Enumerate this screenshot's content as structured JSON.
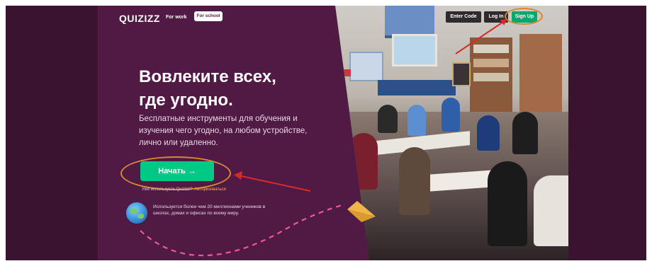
{
  "header": {
    "logo_text": "QUIZIZZ",
    "nav": {
      "for_work": "For work",
      "for_school": "For school"
    },
    "actions": {
      "enter_code": "Enter Code",
      "log_in": "Log In",
      "sign_up": "Sign Up"
    }
  },
  "hero": {
    "headline": "Вовлеките всех,\nгде угодно.",
    "subtitle": "Бесплатные инструменты для обучения и изучения чего угодно, на любом устройстве, лично или удаленно.",
    "cta_label": "Начать",
    "cta_arrow": "→",
    "already_text": "Уже используете Quizizz?",
    "login_link": "Авторизоваться",
    "stat_text": "Используется более чем 20 миллионами учеников в школах, домах и офисах по всему миру."
  },
  "colors": {
    "brand_purple": "#4b1a3f",
    "accent_green": "#00c985",
    "annotation_red": "#d62b2b",
    "annotation_orange": "#d9882f",
    "dash_pink": "#e85b97"
  },
  "icons": [
    "globe-icon",
    "paper-plane-icon",
    "arrow-right-icon"
  ]
}
